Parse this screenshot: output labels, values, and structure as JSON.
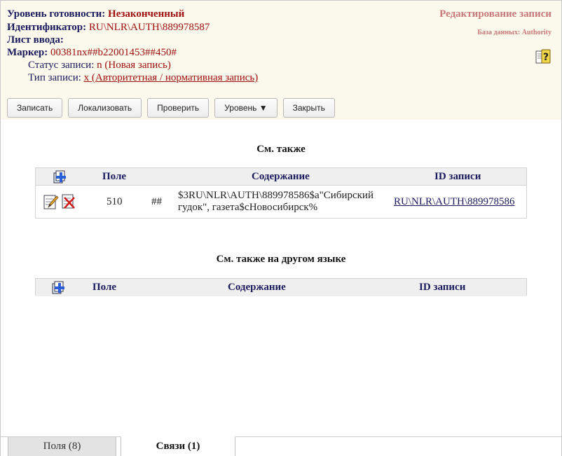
{
  "header": {
    "readiness_label": "Уровень готовности:",
    "readiness_value": "Незаконченный",
    "identifier_label": "Идентификатор:",
    "identifier_value": "RU\\NLR\\AUTH\\889978587",
    "input_sheet_label": "Лист ввода:",
    "marker_label": "Маркер:",
    "marker_value": "00381nx##b22001453##450#",
    "status_label": "Статус записи:",
    "status_value": "n (Новая запись)",
    "type_label": "Тип записи:",
    "type_value": "x (Авторитетная / нормативная запись)",
    "edit_title": "Редактирование записи",
    "database": "База данных: Authority",
    "help_icon": "help-question-icon"
  },
  "toolbar": {
    "save_label": "Записать",
    "localize_label": "Локализовать",
    "check_label": "Проверить",
    "level_label": "Уровень ▼",
    "close_label": "Закрыть"
  },
  "see_also": {
    "title": "См. также",
    "columns": [
      "Поле",
      "Содержание",
      "ID записи"
    ],
    "rows": [
      {
        "field": "510",
        "indicators": "##",
        "content": "$3RU\\NLR\\AUTH\\889978586$a\"Сибирский гудок\", газета$cНовосибирск%",
        "record_id": "RU\\NLR\\AUTH\\889978586"
      }
    ]
  },
  "see_also_other_lang": {
    "title": "См. также на другом языке",
    "columns": [
      "Поле",
      "Содержание",
      "ID записи"
    ]
  },
  "tabs": {
    "fields": "Поля (8)",
    "links": "Связи (1)"
  },
  "colors": {
    "header_bg": "#fbf8ec",
    "label": "#1a1a5e",
    "value": "#a01010",
    "edit_title": "#c87878"
  }
}
